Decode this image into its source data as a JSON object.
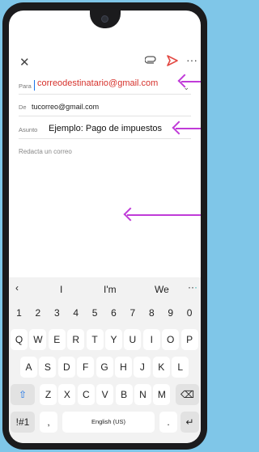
{
  "toolbar": {
    "close_icon": "close-icon",
    "attach_icon": "paperclip-icon",
    "send_icon": "send-icon",
    "more_icon": "more-icon",
    "send_color": "#e34a44"
  },
  "fields": {
    "to_label": "Para",
    "to_value": "correodestinatario@gmail.com",
    "from_label": "De",
    "from_value": "tucorreo@gmail.com",
    "subject_label": "Asunto",
    "subject_value": "Ejemplo: Pago de impuestos",
    "body_placeholder": "Redacta un correo"
  },
  "keyboard": {
    "suggestions": [
      "I",
      "I'm",
      "We"
    ],
    "numbers": [
      "1",
      "2",
      "3",
      "4",
      "5",
      "6",
      "7",
      "8",
      "9",
      "0"
    ],
    "row1": [
      "Q",
      "W",
      "E",
      "R",
      "T",
      "Y",
      "U",
      "I",
      "O",
      "P"
    ],
    "row2": [
      "A",
      "S",
      "D",
      "F",
      "G",
      "H",
      "J",
      "K",
      "L"
    ],
    "row3": [
      "Z",
      "X",
      "C",
      "V",
      "B",
      "N",
      "M"
    ],
    "symbols_label": "!#1",
    "comma_label": ",",
    "space_label": "English (US)",
    "period_label": "."
  },
  "annotation_color": "#c03bd8"
}
